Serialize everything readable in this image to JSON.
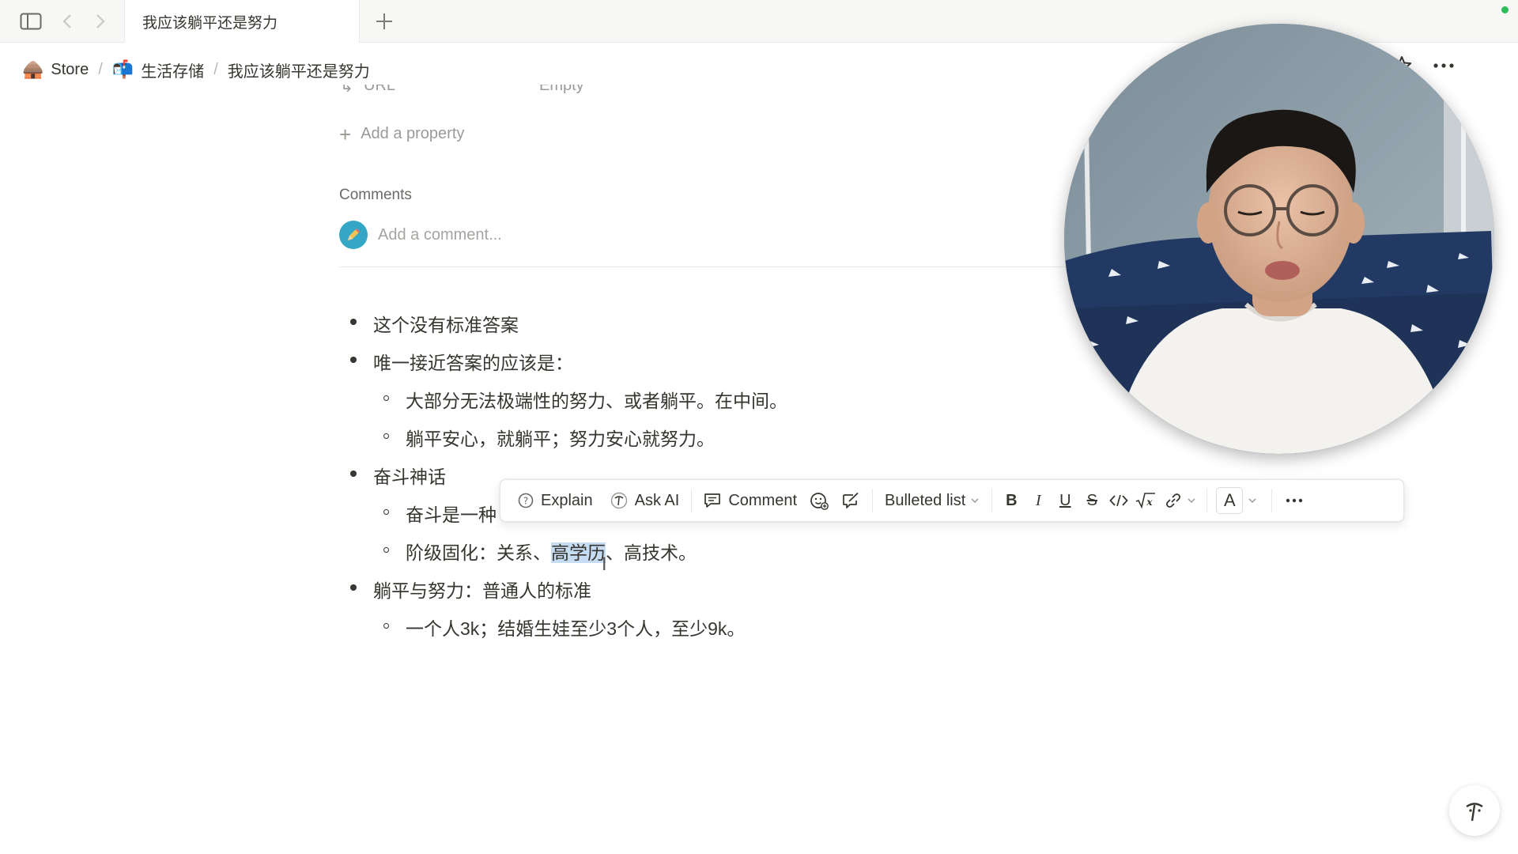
{
  "tabbar": {
    "active_tab": "我应该躺平还是努力",
    "icons": [
      "sidebar-toggle-icon",
      "back-arrow-icon",
      "forward-arrow-icon",
      "new-tab-plus-icon"
    ]
  },
  "breadcrumb": [
    {
      "emoji": "🛖",
      "label": "Store"
    },
    {
      "emoji": "📬",
      "label": "生活存储"
    },
    {
      "emoji": "",
      "label": "我应该躺平还是努力"
    }
  ],
  "properties": {
    "peek_name": "URL",
    "peek_value": "Empty",
    "add_property": "Add a property"
  },
  "comments": {
    "heading": "Comments",
    "placeholder": "Add a comment..."
  },
  "content": {
    "items": [
      {
        "text": "这个没有标准答案"
      },
      {
        "text": "唯一接近答案的应该是："
      },
      {
        "text": "大部分无法极端性的努力、或者躺平。在中间。"
      },
      {
        "text": "躺平安心，就躺平；努力安心就努力。"
      },
      {
        "text": "奋斗神话"
      },
      {
        "text": "奋斗是一种"
      },
      {
        "text_before": "阶级固化：关系、",
        "text_selected": "高学历",
        "text_after": "、高技术。"
      },
      {
        "text": "躺平与努力：普通人的标准"
      },
      {
        "text": "一个人3k；结婚生娃至少3个人，至少9k。"
      }
    ]
  },
  "toolbar": {
    "explain": "Explain",
    "ask_ai": "Ask AI",
    "comment": "Comment",
    "block_type": "Bulleted list",
    "bold": "B",
    "italic": "I",
    "underline": "U",
    "strike": "S",
    "color": "A"
  },
  "colors": {
    "selection": "#c6dcf3",
    "text": "#37352f",
    "muted": "#9b9a97",
    "status_dot": "#2fbd57"
  }
}
